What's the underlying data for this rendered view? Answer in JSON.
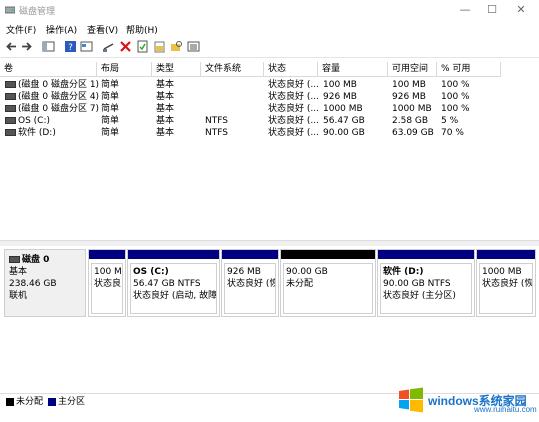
{
  "window": {
    "title": "磁盘管理",
    "min": "—",
    "max": "☐",
    "close": "✕"
  },
  "menu": [
    "文件(F)",
    "操作(A)",
    "查看(V)",
    "帮助(H)"
  ],
  "columns": [
    "卷",
    "布局",
    "类型",
    "文件系统",
    "状态",
    "容量",
    "可用空间",
    "% 可用"
  ],
  "volumes": [
    [
      "(磁盘 0 磁盘分区 1)",
      "简单",
      "基本",
      "",
      "状态良好 (...",
      "100 MB",
      "100 MB",
      "100 %"
    ],
    [
      "(磁盘 0 磁盘分区 4)",
      "简单",
      "基本",
      "",
      "状态良好 (...",
      "926 MB",
      "926 MB",
      "100 %"
    ],
    [
      "(磁盘 0 磁盘分区 7)",
      "简单",
      "基本",
      "",
      "状态良好 (...",
      "1000 MB",
      "1000 MB",
      "100 %"
    ],
    [
      "OS (C:)",
      "简单",
      "基本",
      "NTFS",
      "状态良好 (...",
      "56.47 GB",
      "2.58 GB",
      "5 %"
    ],
    [
      "软件 (D:)",
      "简单",
      "基本",
      "NTFS",
      "状态良好 (...",
      "90.00 GB",
      "63.09 GB",
      "70 %"
    ]
  ],
  "disk": {
    "name": "磁盘 0",
    "type": "基本",
    "size": "238.46 GB",
    "status": "联机"
  },
  "partitions": [
    {
      "name": "",
      "line1": "100 MI",
      "line2": "状态良",
      "bar": "#000080"
    },
    {
      "name": "OS  (C:)",
      "line1": "56.47 GB NTFS",
      "line2": "状态良好 (启动, 故障转",
      "bar": "#000080"
    },
    {
      "name": "",
      "line1": "926 MB",
      "line2": "状态良好 (恢",
      "bar": "#000080"
    },
    {
      "name": "",
      "line1": "90.00 GB",
      "line2": "未分配",
      "bar": "#000000"
    },
    {
      "name": "软件  (D:)",
      "line1": "90.00 GB NTFS",
      "line2": "状态良好 (主分区)",
      "bar": "#000080"
    },
    {
      "name": "",
      "line1": "1000 MB",
      "line2": "状态良好 (恢",
      "bar": "#000080"
    }
  ],
  "legend": [
    {
      "label": "未分配",
      "color": "#000000"
    },
    {
      "label": "主分区",
      "color": "#000080"
    }
  ],
  "watermark": {
    "main": "windows系统家园",
    "sub": "www.ruihaitu.com"
  }
}
